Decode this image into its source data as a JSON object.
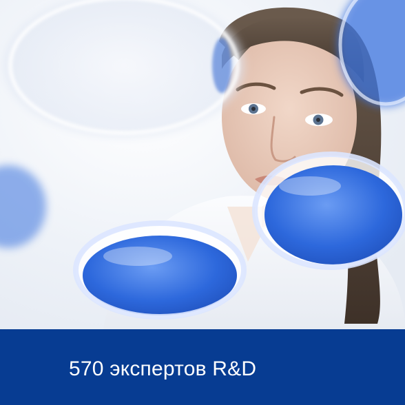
{
  "caption": {
    "text": "570 экспертов R&D"
  },
  "colors": {
    "banner": "#073c92",
    "caption_text": "#ffffff",
    "petri_blue": "#2f6fe0",
    "background": "#f1f4f9"
  },
  "photo": {
    "icon": "scientist-photo"
  }
}
